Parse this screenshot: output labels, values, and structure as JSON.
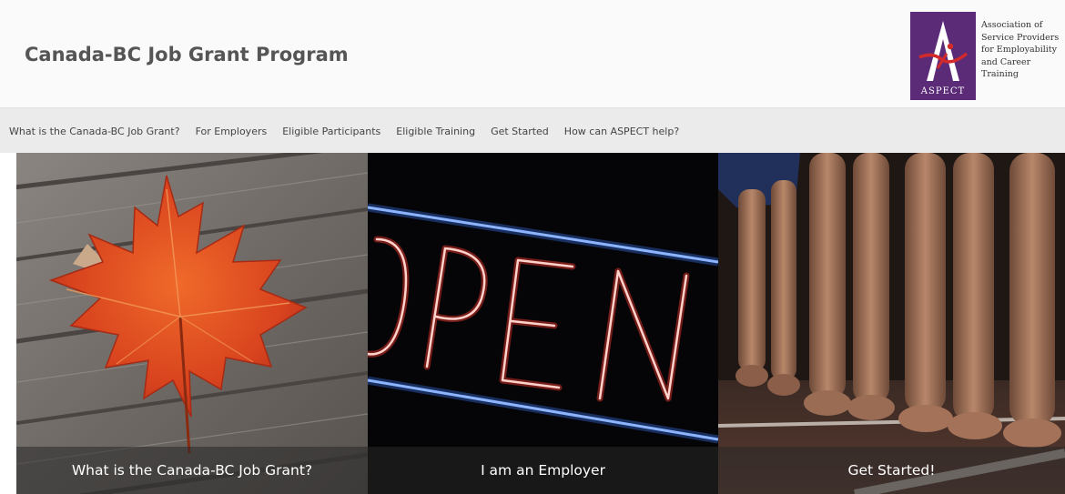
{
  "header": {
    "title": "Canada-BC Job Grant Program",
    "logo": {
      "mark_text": "ASPECT",
      "lines": [
        "Association of",
        "Service Providers",
        "for Employability",
        "and Career",
        "Training"
      ],
      "color": "#5b2b78"
    }
  },
  "nav": {
    "items": [
      "What is the Canada-BC Job Grant?",
      "For Employers",
      "Eligible Participants",
      "Eligible Training",
      "Get Started",
      "How can ASPECT help?"
    ]
  },
  "tiles": [
    {
      "caption": "What is the Canada-BC Job Grant?",
      "image": "maple-leaf-on-wood"
    },
    {
      "caption": "I am an Employer",
      "image": "neon-open-sign"
    },
    {
      "caption": "Get Started!",
      "image": "runners-at-starting-line"
    }
  ],
  "colors": {
    "title": "#555555",
    "nav_background": "#ebebeb",
    "caption_overlay": "rgba(40,40,40,0.55)",
    "neon_red": "#ff3b2f",
    "neon_blue": "#3d7bff"
  }
}
